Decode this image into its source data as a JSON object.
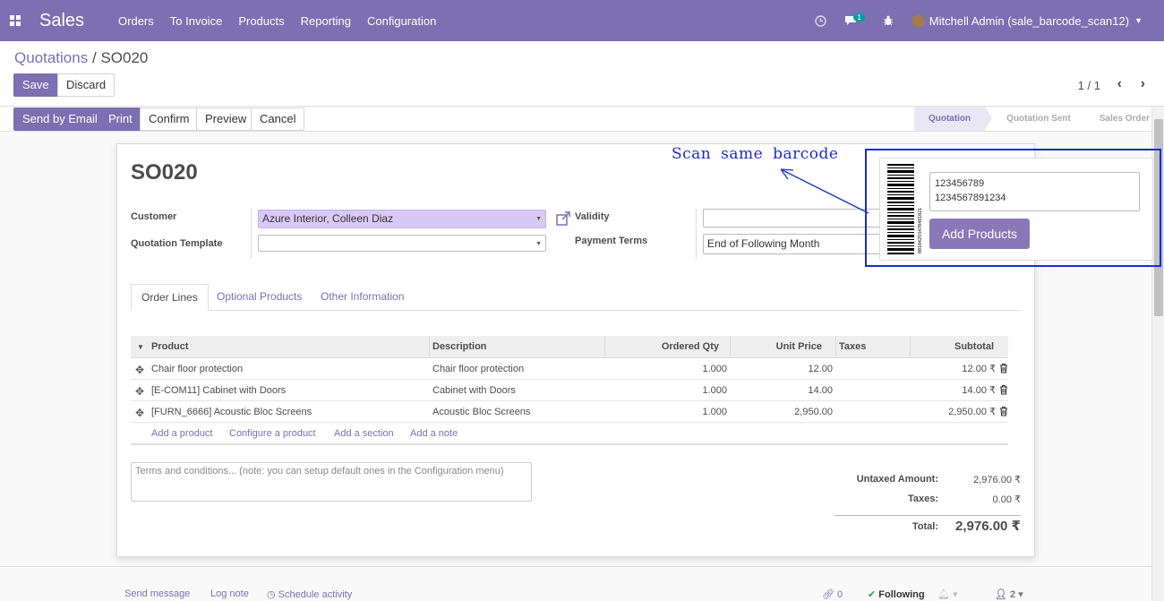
{
  "navbar": {
    "brand": "Sales",
    "menu": [
      "Orders",
      "To Invoice",
      "Products",
      "Reporting",
      "Configuration"
    ],
    "chat_count": "1",
    "user": "Mitchell Admin (sale_barcode_scan12)"
  },
  "breadcrumb": {
    "parent": "Quotations",
    "separator": "/",
    "current": "SO020"
  },
  "actions": {
    "save": "Save",
    "discard": "Discard"
  },
  "pager": {
    "value": "1 / 1"
  },
  "status_buttons": {
    "send_by_email": "Send by Email",
    "print": "Print",
    "confirm": "Confirm",
    "preview": "Preview",
    "cancel": "Cancel"
  },
  "stages": [
    "Quotation",
    "Quotation Sent",
    "Sales Order"
  ],
  "form": {
    "name": "SO020",
    "customer_label": "Customer",
    "customer_value": "Azure Interior, Colleen Diaz",
    "template_label": "Quotation Template",
    "template_value": "",
    "validity_label": "Validity",
    "validity_value": "",
    "payment_terms_label": "Payment Terms",
    "payment_terms_value": "End of Following Month"
  },
  "tabs": [
    "Order Lines",
    "Optional Products",
    "Other Information"
  ],
  "table": {
    "headers": [
      "Product",
      "Description",
      "Ordered Qty",
      "Unit Price",
      "Taxes",
      "Subtotal"
    ],
    "rows": [
      {
        "product": "Chair floor protection",
        "description": "Chair floor protection",
        "qty": "1.000",
        "price": "12.00",
        "taxes": "",
        "subtotal": "12.00 ₹"
      },
      {
        "product": "[E-COM11] Cabinet with Doors",
        "description": "Cabinet with Doors",
        "qty": "1.000",
        "price": "14.00",
        "taxes": "",
        "subtotal": "14.00 ₹"
      },
      {
        "product": "[FURN_6666] Acoustic Bloc Screens",
        "description": "Acoustic Bloc Screens",
        "qty": "1.000",
        "price": "2,950.00",
        "taxes": "",
        "subtotal": "2,950.00 ₹"
      }
    ],
    "add_links": [
      "Add a product",
      "Configure a product",
      "Add a section",
      "Add a note"
    ]
  },
  "terms_placeholder": "Terms and conditions... (note: you can setup default ones in the Configuration menu)",
  "totals": {
    "untaxed_label": "Untaxed Amount:",
    "untaxed_value": "2,976.00 ₹",
    "taxes_label": "Taxes:",
    "taxes_value": "0.00 ₹",
    "total_label": "Total:",
    "total_value": "2,976.00 ₹"
  },
  "chatter": {
    "send_message": "Send message",
    "log_note": "Log note",
    "schedule_activity": "Schedule activity",
    "attachments": "0",
    "following": "Following",
    "followers": "2"
  },
  "annotation": {
    "text": "Scan same barcode"
  },
  "scan_panel": {
    "barcode_lines": [
      "123456789",
      "1234567891234"
    ],
    "add_products": "Add Products",
    "barcode_caption": "00104293470481021"
  },
  "colors": {
    "brand": "#7c6fb2",
    "annotation": "#1a2bd1",
    "customer_field": "#d8c9f7"
  }
}
